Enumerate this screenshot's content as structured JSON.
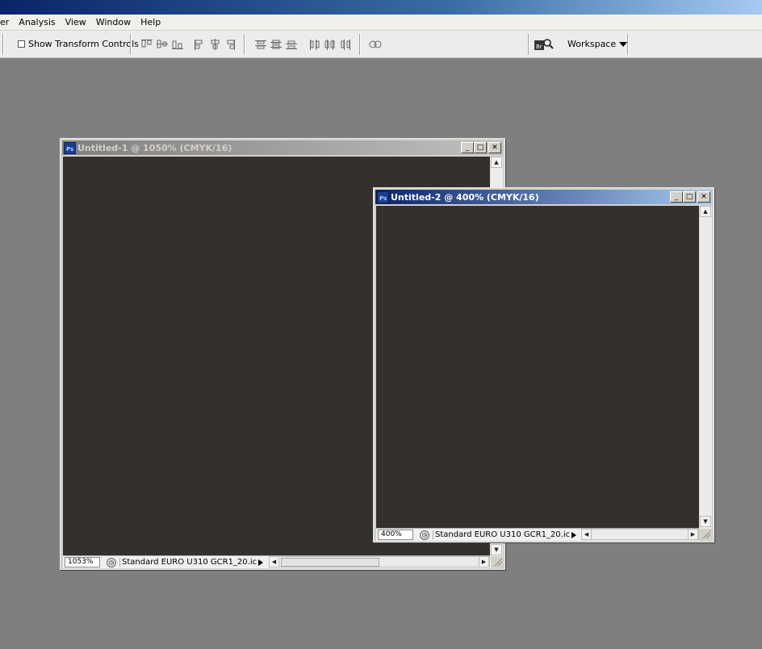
{
  "menubar": {
    "items": [
      "er",
      "Analysis",
      "View",
      "Window",
      "Help"
    ]
  },
  "options_bar": {
    "show_transform_controls_label": "Show Transform Controls",
    "workspace_label": "Workspace"
  },
  "documents": [
    {
      "title": "Untitled-1 @ 1050% (CMYK/16)",
      "zoom": "1053%",
      "profile": "Standard EURO U310 GCR1_20.icc ...",
      "state": "inactive",
      "canvas_color": "#33302d"
    },
    {
      "title": "Untitled-2 @ 400% (CMYK/16)",
      "zoom": "400%",
      "profile": "Standard EURO U310 GCR1_20.icc ...",
      "state": "active",
      "canvas_color": "#33302d"
    }
  ],
  "colors": {
    "workspace_bg": "#7f7f7f",
    "active_title": "#0a246a",
    "inactive_title": "#808080"
  }
}
